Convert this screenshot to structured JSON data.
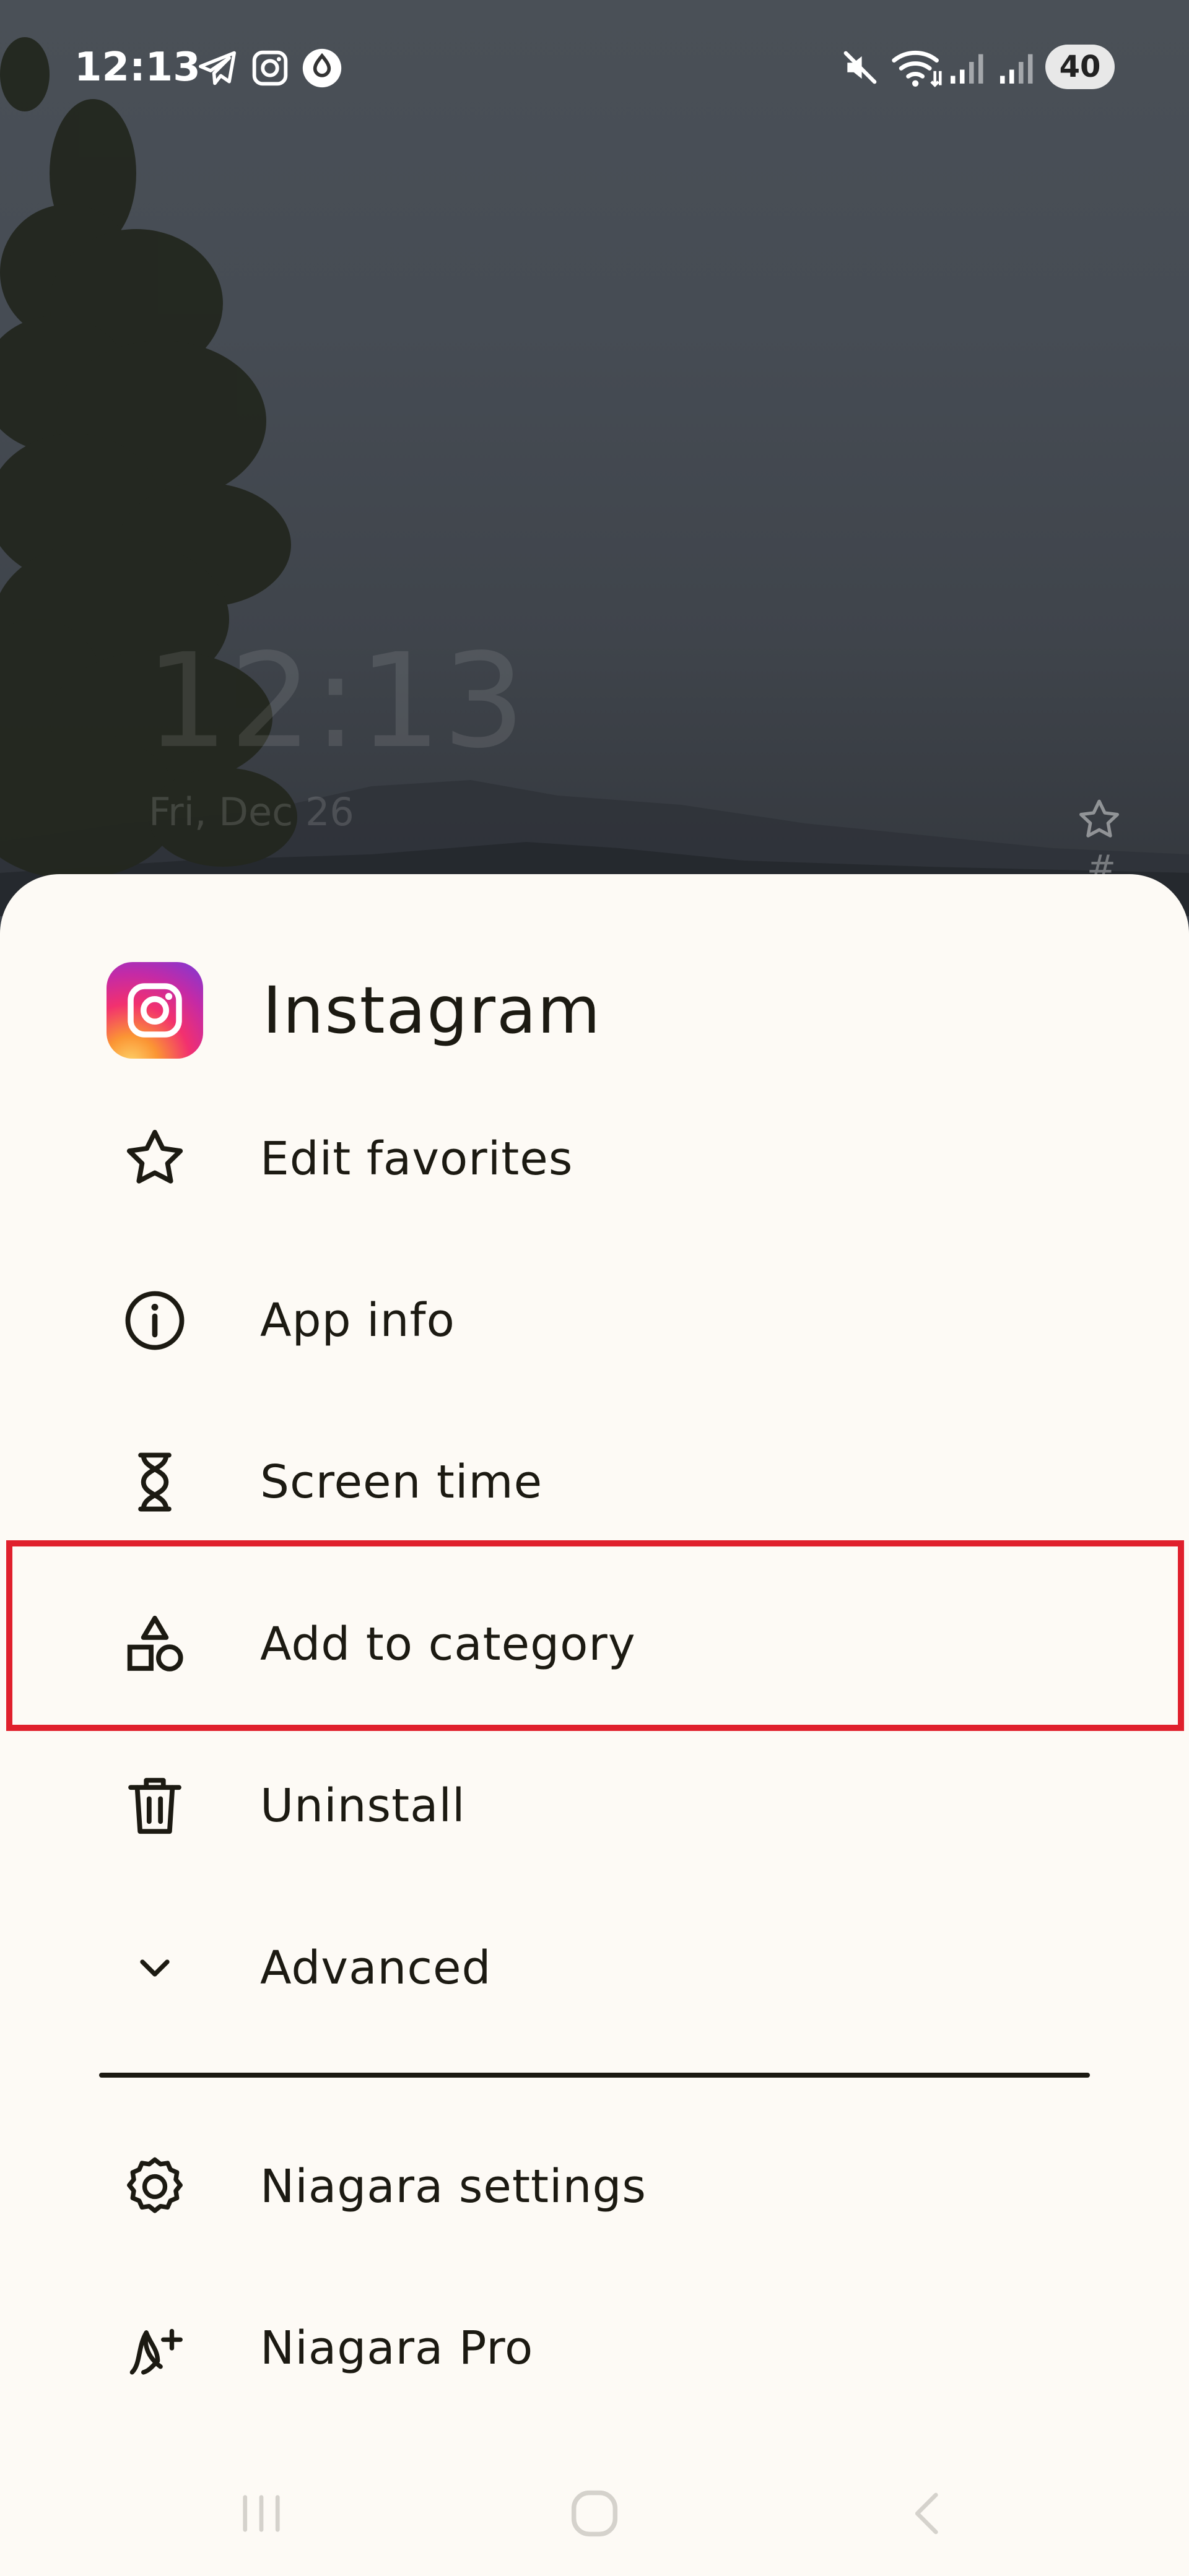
{
  "status_bar": {
    "time": "12:13",
    "battery": "40",
    "left_icons": [
      "telegram-icon",
      "instagram-icon",
      "drop-icon"
    ],
    "right_icons": [
      "mute-icon",
      "wifi-icon",
      "signal-icon",
      "signal-icon"
    ]
  },
  "home": {
    "clock": "12:13",
    "date": "Fri, Dec 26",
    "hash": "#"
  },
  "sheet": {
    "app_name": "Instagram",
    "menu": [
      {
        "label": "Edit favorites",
        "icon": "star-icon"
      },
      {
        "label": "App info",
        "icon": "info-icon"
      },
      {
        "label": "Screen time",
        "icon": "hourglass-icon"
      },
      {
        "label": "Add to category",
        "icon": "shapes-icon"
      },
      {
        "label": "Uninstall",
        "icon": "trash-icon"
      },
      {
        "label": "Advanced",
        "icon": "chevron-down-icon"
      }
    ],
    "footer_menu": [
      {
        "label": "Niagara settings",
        "icon": "gear-icon"
      },
      {
        "label": "Niagara Pro",
        "icon": "niagara-pro-icon"
      }
    ]
  },
  "colors": {
    "sheet_bg": "#fdfaf5",
    "text": "#1c1a12",
    "highlight": "#e0202c"
  }
}
